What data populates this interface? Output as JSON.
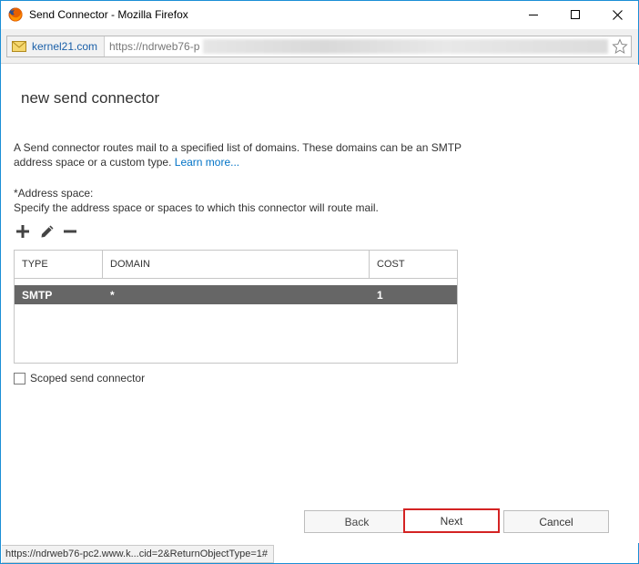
{
  "window": {
    "title": "Send Connector - Mozilla Firefox"
  },
  "urlbar": {
    "site_name": "kernel21.com",
    "url": "https://ndrweb76-p"
  },
  "page": {
    "title": "new send connector",
    "description": "A Send connector routes mail to a specified list of domains. These domains can be an SMTP address space or a custom type.",
    "learn_more": "Learn more...",
    "address_space_label": "*Address space:",
    "address_space_desc": "Specify the address space or spaces to which this connector will route mail."
  },
  "grid": {
    "columns": [
      "TYPE",
      "DOMAIN",
      "COST"
    ],
    "rows": [
      {
        "type": "SMTP",
        "domain": "*",
        "cost": "1"
      }
    ]
  },
  "scoped": {
    "label": "Scoped send connector",
    "checked": false
  },
  "buttons": {
    "back": "Back",
    "next": "Next",
    "cancel": "Cancel"
  },
  "statusbar": {
    "text": "https://ndrweb76-pc2.www.k...cid=2&ReturnObjectType=1#"
  },
  "colors": {
    "link": "#0072c6",
    "selected_row": "#666666",
    "highlight_border": "#d42323",
    "window_border": "#1b8fd6"
  }
}
